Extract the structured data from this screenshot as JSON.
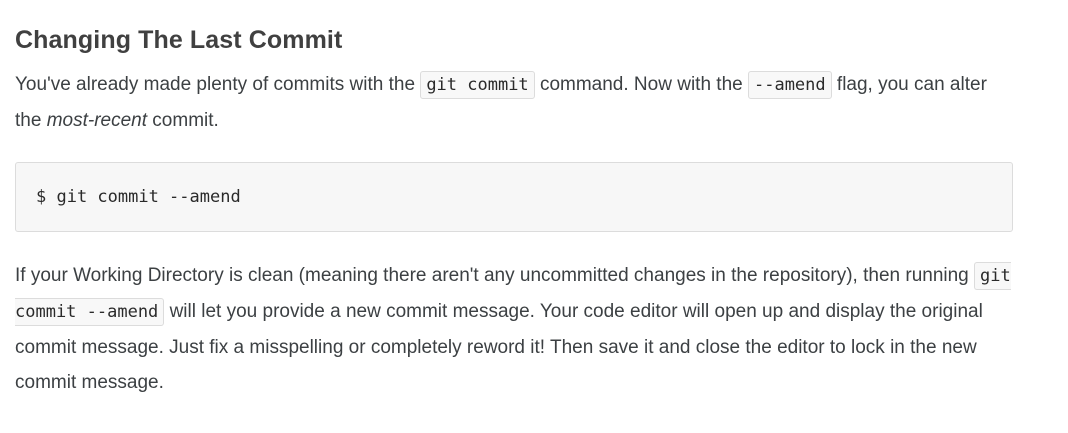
{
  "heading": "Changing The Last Commit",
  "intro": {
    "text1": "You've already made plenty of commits with the ",
    "code1": "git commit",
    "text2": " command. Now with the ",
    "code2": "--amend",
    "text3": " flag, you can alter the ",
    "emphasis": "most-recent",
    "text4": " commit."
  },
  "code_block": {
    "command": "$ git commit --amend"
  },
  "explanation": {
    "text1": "If your Working Directory is clean (meaning there aren't any uncommitted changes in the repository), then running ",
    "code1": "git commit --amend",
    "text2": " will let you provide a new commit message. Your code editor will open up and display the original commit message. Just fix a misspelling or completely reword it! Then save it and close the editor to lock in the new commit message."
  }
}
